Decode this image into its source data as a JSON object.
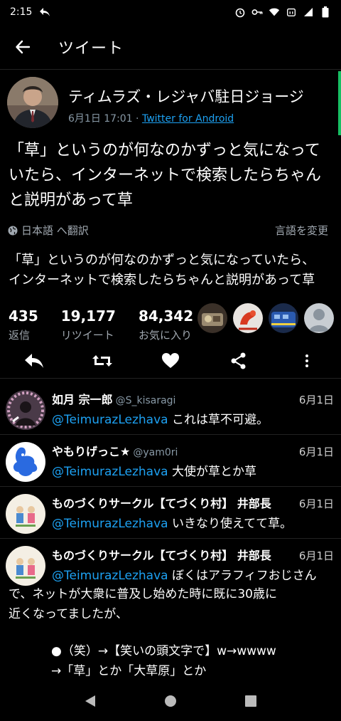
{
  "status": {
    "time": "2:15"
  },
  "appbar": {
    "title": "ツイート"
  },
  "tweet": {
    "author_name": "ティムラズ・レジャバ駐日ジョージ",
    "timestamp": "6月1日 17:01 · ",
    "client": "Twitter for Android",
    "text_lines": [
      "「草」というのが何なのかずっと気になって",
      "いたら、インターネットで検索したらちゃん",
      "と説明があって草"
    ],
    "translate_label": "日本語 へ翻訳",
    "change_language": "言語を変更",
    "translated_lines": [
      "「草」というのが何なのかずっと気になっていたら、",
      "インターネットで検索したらちゃんと説明があって草"
    ],
    "stats": {
      "replies": {
        "num": "435",
        "label": "返信"
      },
      "retweets": {
        "num": "19,177",
        "label": "リツイート"
      },
      "likes": {
        "num": "84,342",
        "label": "お気に入り"
      }
    }
  },
  "replies": [
    {
      "name": "如月 宗一郎",
      "handle": "@S_kisaragi",
      "date": "6月1日",
      "mention": "@TeimurazLezhava",
      "text": " これは草不可避。"
    },
    {
      "name": "やもりげっこ★",
      "handle": "@yam0ri",
      "date": "6月1日",
      "mention": "@TeimurazLezhava",
      "text": " 大使が草とか草"
    },
    {
      "name": "ものづくりサークル【てづくり村】 井部長",
      "handle": "",
      "date": "6月1日",
      "mention": "@TeimurazLezhava",
      "text": " いきなり使えてて草。"
    },
    {
      "name": "ものづくりサークル【てづくり村】 井部長",
      "handle": "",
      "date": "6月1日",
      "mention": "@TeimurazLezhava",
      "text": " ぼくはアラフィフおじさん",
      "lines": [
        "で、ネットが大衆に普及し始めた時に既に30歳に",
        "近くなってましたが、"
      ],
      "lines2": [
        "●（笑）→【笑いの頭文字で】w→wwww",
        "→「草」とか「大草原」とか"
      ]
    }
  ]
}
